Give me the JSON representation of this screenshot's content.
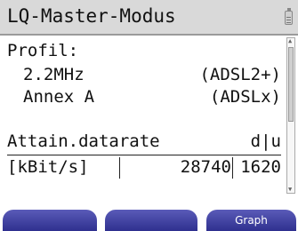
{
  "title": "LQ-Master-Modus",
  "profile": {
    "label": "Profil:",
    "frequency": "2.2MHz",
    "mode": "(ADSL2+)",
    "annex": "Annex A",
    "annex_type": "(ADSLx)"
  },
  "attain": {
    "label": "Attain.datarate",
    "header": "d|u",
    "unit": "[kBit/s]",
    "down": "28740",
    "up": "1620"
  },
  "softkeys": [
    "",
    "",
    "Graph"
  ],
  "icons": {
    "battery": "battery-icon",
    "scroll_up": "scroll-up-arrow-icon",
    "scroll_down": "scroll-down-arrow-icon"
  }
}
